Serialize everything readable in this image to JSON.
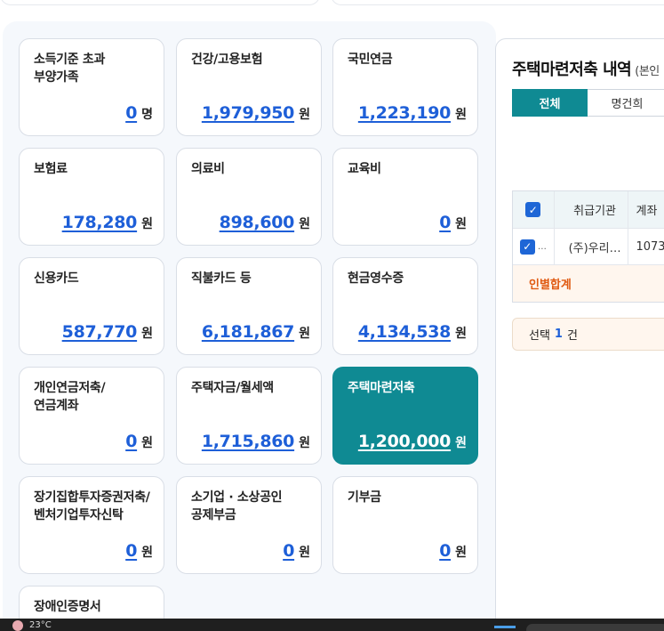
{
  "cards": [
    {
      "title": "소득기준 초과\n부양가족",
      "value": "0",
      "unit": "명"
    },
    {
      "title": "건강/고용보험",
      "value": "1,979,950",
      "unit": "원"
    },
    {
      "title": "국민연금",
      "value": "1,223,190",
      "unit": "원"
    },
    {
      "title": "보험료",
      "value": "178,280",
      "unit": "원"
    },
    {
      "title": "의료비",
      "value": "898,600",
      "unit": "원"
    },
    {
      "title": "교육비",
      "value": "0",
      "unit": "원"
    },
    {
      "title": "신용카드",
      "value": "587,770",
      "unit": "원"
    },
    {
      "title": "직불카드 등",
      "value": "6,181,867",
      "unit": "원"
    },
    {
      "title": "현금영수증",
      "value": "4,134,538",
      "unit": "원"
    },
    {
      "title": "개인연금저축/\n연금계좌",
      "value": "0",
      "unit": "원"
    },
    {
      "title": "주택자금/월세액",
      "value": "1,715,860",
      "unit": "원"
    },
    {
      "title": "주택마련저축",
      "value": "1,200,000",
      "unit": "원"
    },
    {
      "title": "장기집합투자증권저축/\n벤처기업투자신탁",
      "value": "0",
      "unit": "원"
    },
    {
      "title": "소기업 · 소상공인\n공제부금",
      "value": "0",
      "unit": "원"
    },
    {
      "title": "기부금",
      "value": "0",
      "unit": "원"
    },
    {
      "title": "장애인증명서"
    }
  ],
  "detail": {
    "title": "주택마련저축 내역",
    "subtitle": "(본인",
    "tabs": [
      "전체",
      "명건희"
    ],
    "table": {
      "headers": [
        "취급기관",
        "계좌"
      ],
      "rows": [
        [
          "(주)우리…",
          "1073"
        ]
      ],
      "ellipsis": "…",
      "sum_label": "인별합계"
    },
    "selection": {
      "prefix": "선택",
      "count": "1",
      "suffix": "건"
    }
  },
  "taskbar": {
    "text": "23°C"
  },
  "colors": {
    "accent": "#0f8a93",
    "link_blue": "#1e5fd8",
    "sum_orange": "#e05a12",
    "checkbox_blue": "#1e66d6"
  }
}
